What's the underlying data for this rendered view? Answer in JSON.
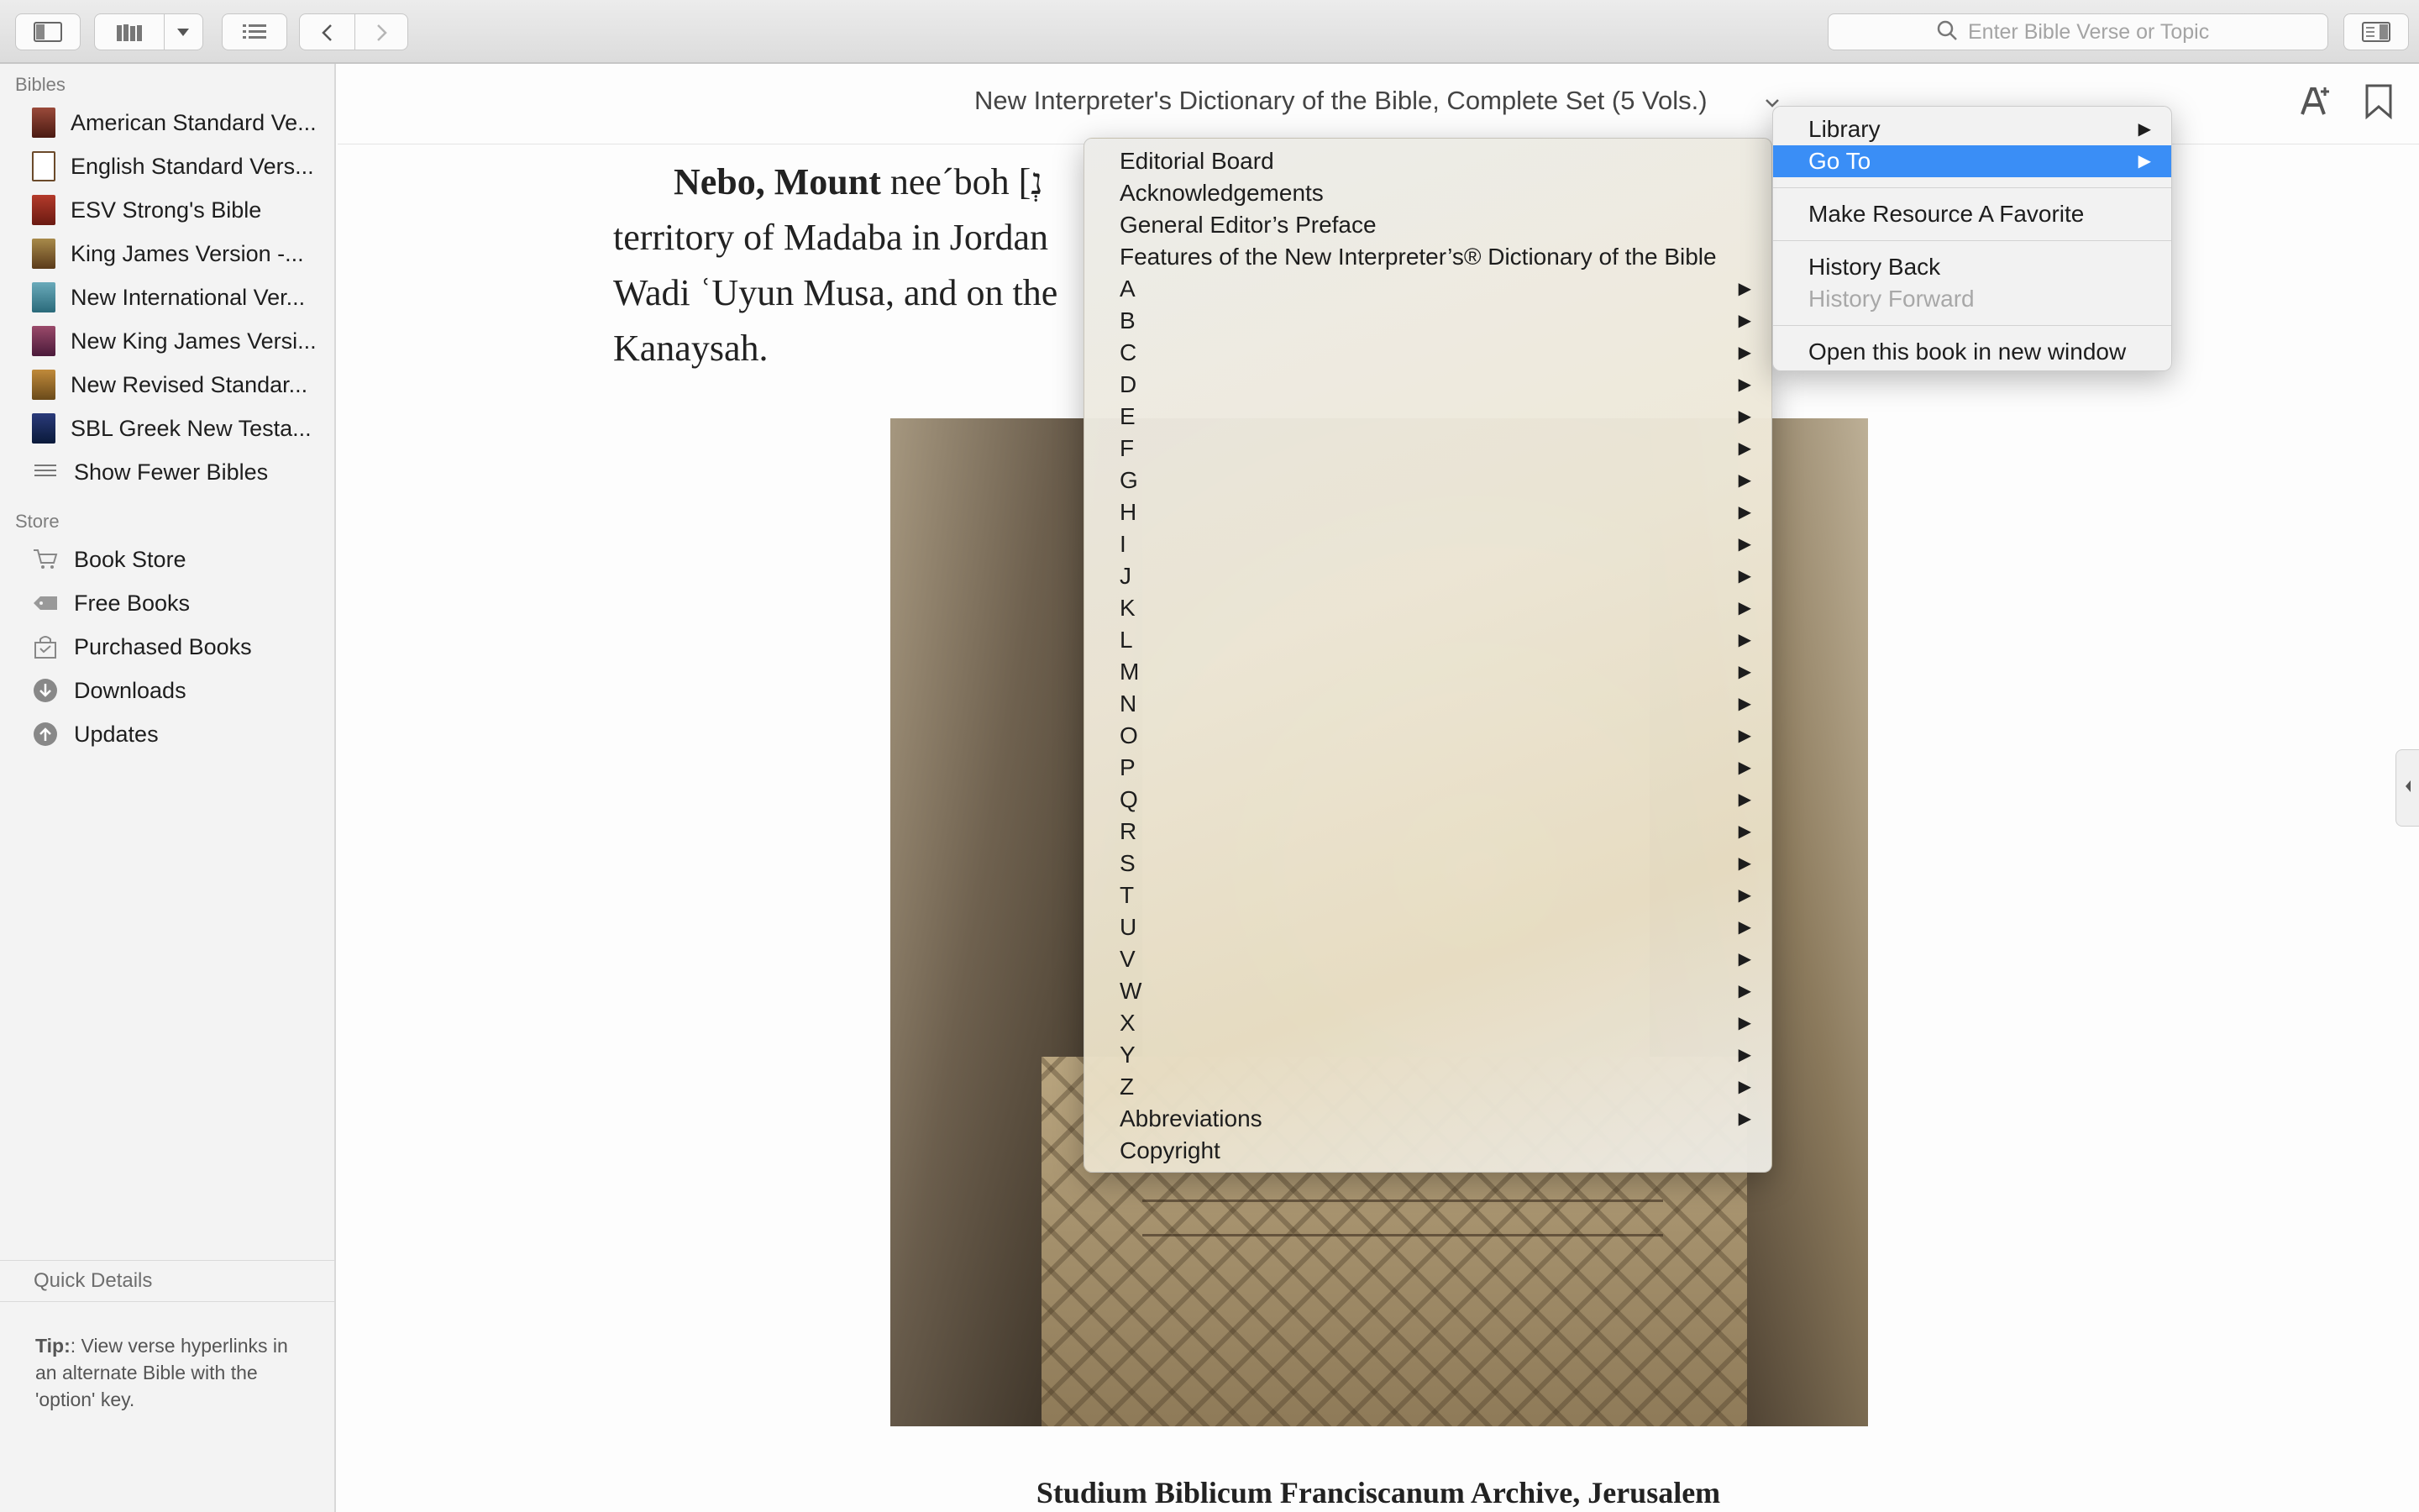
{
  "toolbar": {
    "search_placeholder": "Enter Bible Verse or Topic",
    "icons": [
      "sidebar-toggle-icon",
      "library-icon",
      "dropdown-arrow-icon",
      "list-icon",
      "back-arrow-icon",
      "forward-arrow-icon",
      "search-icon",
      "split-view-icon"
    ]
  },
  "sidebar": {
    "bibles_header": "Bibles",
    "bibles": [
      {
        "label": "American Standard Ve...",
        "color": "#7a3a2a"
      },
      {
        "label": "English Standard Vers...",
        "color": "#ffffff"
      },
      {
        "label": "ESV Strong's Bible",
        "color": "#8a2a1e"
      },
      {
        "label": "King James Version -...",
        "color": "#8a6a2a"
      },
      {
        "label": "New International Ver...",
        "color": "#4a8a9a"
      },
      {
        "label": "New King James Versi...",
        "color": "#7a3a4a"
      },
      {
        "label": "New Revised Standar...",
        "color": "#9a6a2a"
      },
      {
        "label": "SBL Greek New Testa...",
        "color": "#1a2a5a"
      }
    ],
    "show_fewer": "Show Fewer Bibles",
    "store_header": "Store",
    "store": [
      {
        "label": "Book Store",
        "icon": "cart-icon"
      },
      {
        "label": "Free Books",
        "icon": "tag-icon"
      },
      {
        "label": "Purchased Books",
        "icon": "bag-icon"
      },
      {
        "label": "Downloads",
        "icon": "download-icon"
      },
      {
        "label": "Updates",
        "icon": "upload-icon"
      }
    ],
    "quick_details": "Quick Details",
    "tip_label": "Tip:",
    "tip_text": ": View verse hyperlinks in an alternate Bible with the 'option' key."
  },
  "content": {
    "resource_title": "New Interpreter's Dictionary of the Bible, Complete Set (5 Vols.)",
    "article_term": "Nebo, Mount",
    "article_line1_rest": " nee´boh [נְ",
    "article_line2": "territory of Madaba in Jordan",
    "article_line3": "Wadi ʿUyun Musa, and on the",
    "article_line4": "Kanaysah.",
    "caption": "Studium Biblicum Franciscanum Archive, Jerusalem"
  },
  "menu": {
    "items": [
      {
        "label": "Library",
        "has_sub": true
      },
      {
        "label": "Go To",
        "has_sub": true,
        "selected": true
      }
    ],
    "favorite": "Make Resource A Favorite",
    "history_back": "History Back",
    "history_forward": "History Forward",
    "open_window": "Open this book in new window"
  },
  "goto_menu": {
    "front": [
      "Editorial Board",
      "Acknowledgements",
      "General Editor’s Preface",
      "Features of the New Interpreter’s® Dictionary of the Bible"
    ],
    "letters": [
      "A",
      "B",
      "C",
      "D",
      "E",
      "F",
      "G",
      "H",
      "I",
      "J",
      "K",
      "L",
      "M",
      "N",
      "O",
      "P",
      "Q",
      "R",
      "S",
      "T",
      "U",
      "V",
      "W",
      "X",
      "Y",
      "Z"
    ],
    "abbreviations": "Abbreviations",
    "copyright": "Copyright"
  },
  "colors": {
    "selection": "#3a8ef6",
    "sidebar_bg": "#f3f3f3"
  }
}
